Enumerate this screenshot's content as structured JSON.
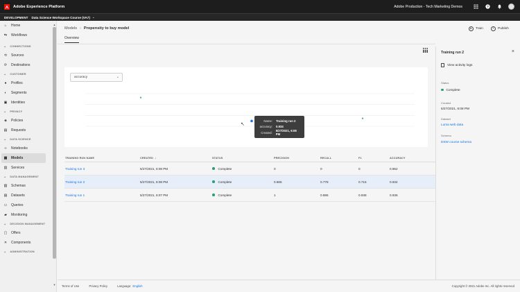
{
  "topbar": {
    "app_title": "Adobe Experience Platform",
    "org_name": "Adobe Production - Tech Marketing Demos",
    "icons": [
      "apps-grid-icon",
      "help-icon",
      "notifications-bell-icon",
      "avatar"
    ]
  },
  "envbar": {
    "env_label": "DEVELOPMENT",
    "sandbox": "Data Science Workspace Course (VA7)"
  },
  "sidebar": {
    "sections": [
      {
        "items": [
          {
            "label": "Home",
            "icon": "home-icon"
          },
          {
            "label": "Workflows",
            "icon": "workflows-icon"
          }
        ]
      },
      {
        "title": "CONNECTIONS",
        "items": [
          {
            "label": "Sources",
            "icon": "sources-icon"
          },
          {
            "label": "Destinations",
            "icon": "destinations-icon"
          }
        ]
      },
      {
        "title": "CUSTOMER",
        "items": [
          {
            "label": "Profiles",
            "icon": "profiles-icon"
          },
          {
            "label": "Segments",
            "icon": "segments-icon"
          },
          {
            "label": "Identities",
            "icon": "identities-icon"
          }
        ]
      },
      {
        "title": "PRIVACY",
        "items": [
          {
            "label": "Policies",
            "icon": "policies-icon"
          },
          {
            "label": "Requests",
            "icon": "requests-icon"
          }
        ]
      },
      {
        "title": "DATA SCIENCE",
        "items": [
          {
            "label": "Notebooks",
            "icon": "notebooks-icon"
          },
          {
            "label": "Models",
            "icon": "models-icon",
            "active": true
          },
          {
            "label": "Services",
            "icon": "services-icon"
          }
        ]
      },
      {
        "title": "DATA MANAGEMENT",
        "items": [
          {
            "label": "Schemas",
            "icon": "schemas-icon"
          },
          {
            "label": "Datasets",
            "icon": "datasets-icon"
          },
          {
            "label": "Queries",
            "icon": "queries-icon"
          },
          {
            "label": "Monitoring",
            "icon": "monitoring-icon"
          }
        ]
      },
      {
        "title": "DECISION MANAGEMENT",
        "items": [
          {
            "label": "Offers",
            "icon": "offers-icon"
          },
          {
            "label": "Components",
            "icon": "components-icon"
          }
        ]
      },
      {
        "title": "ADMINISTRATION",
        "items": []
      }
    ]
  },
  "breadcrumb": {
    "parent": "Models",
    "current": "Propensity to buy model"
  },
  "tabs": {
    "overview": "Overview"
  },
  "actions": {
    "train": "Train",
    "publish": "Publish"
  },
  "chart": {
    "metric_select": "accuracy"
  },
  "chart_data": {
    "type": "scatter",
    "series": [
      {
        "points": [
          {
            "x": "Training run 3",
            "y": 0.952
          },
          {
            "x": "Training run 2",
            "y": 0.934
          },
          {
            "x": "Training run 1",
            "y": 0.936
          }
        ]
      }
    ],
    "tooltip": {
      "name_label": "Name:",
      "name_value": "Training run 2",
      "accuracy_label": "accuracy:",
      "accuracy_value": "0.934",
      "created_label": "Created:",
      "created_value": "5/27/2021, 6:08 PM"
    }
  },
  "table": {
    "headers": [
      "TRAINING RUN NAME",
      "CREATED",
      "STATUS",
      "PRECISION",
      "RECALL",
      "F1",
      "ACCURACY"
    ],
    "rows": [
      {
        "name": "Training run 3",
        "created": "5/27/2021, 6:08 PM",
        "status": "Complete",
        "precision": "0",
        "recall": "0",
        "f1": "0",
        "accuracy": "0.952"
      },
      {
        "name": "Training run 2",
        "created": "5/27/2021, 6:08 PM",
        "status": "Complete",
        "precision": "0.665",
        "recall": "0.778",
        "f1": "0.715",
        "accuracy": "0.934",
        "selected": true
      },
      {
        "name": "Training run 1",
        "created": "5/27/2021, 6:07 PM",
        "status": "Complete",
        "precision": "1",
        "recall": "0.886",
        "f1": "0.938",
        "accuracy": "0.936"
      }
    ]
  },
  "panel": {
    "title": "Training run 2",
    "view_logs": "View activity logs",
    "status_label": "Status",
    "status_value": "Complete",
    "created_label": "Created",
    "created_value": "5/27/2021, 6:08 PM",
    "dataset_label": "Dataset",
    "dataset_value": "Luma web data",
    "schema_label": "Schema",
    "schema_value": "DSW course schema"
  },
  "footer": {
    "terms": "Terms of Use",
    "privacy": "Privacy Policy",
    "language_label": "Language:",
    "language_value": "English",
    "copyright": "Copyright © 2021 Adobe Inc. All rights reserved"
  },
  "colors": {
    "accent_blue": "#1473e6",
    "status_green": "#2d9d78",
    "topbar": "#1d1d1d"
  }
}
